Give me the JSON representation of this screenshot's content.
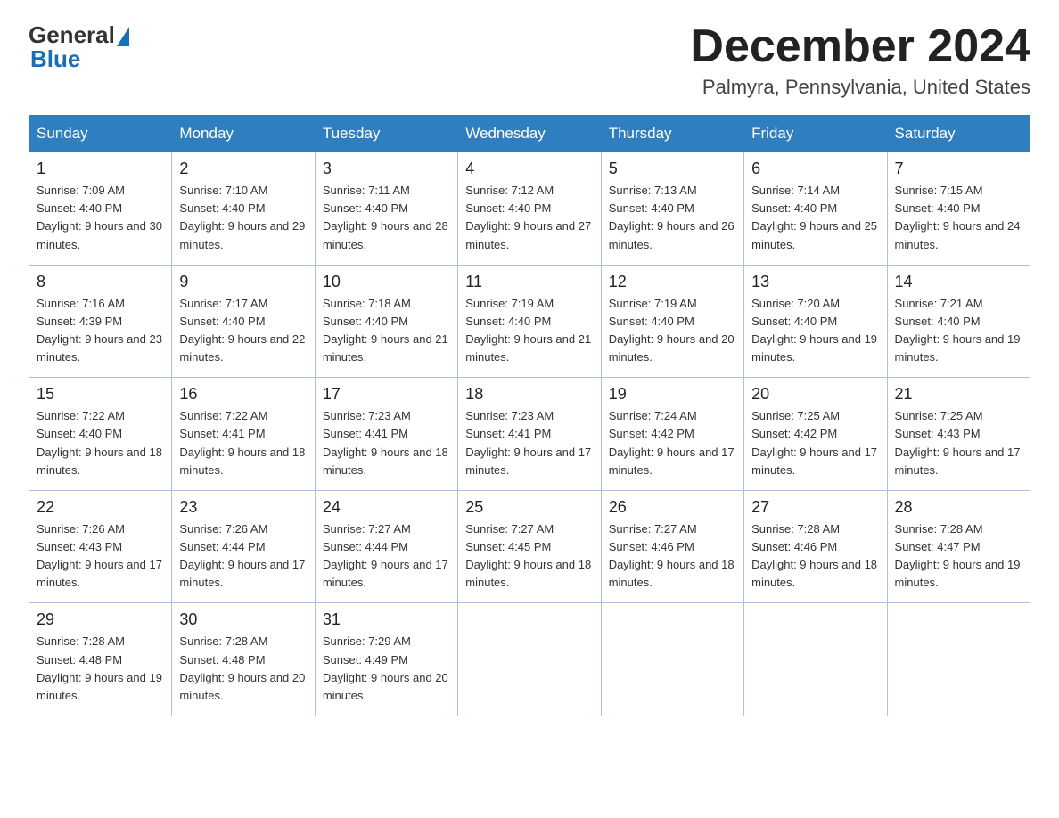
{
  "header": {
    "logo_general": "General",
    "logo_blue": "Blue",
    "month_title": "December 2024",
    "location": "Palmyra, Pennsylvania, United States"
  },
  "days_of_week": [
    "Sunday",
    "Monday",
    "Tuesday",
    "Wednesday",
    "Thursday",
    "Friday",
    "Saturday"
  ],
  "weeks": [
    [
      {
        "day": "1",
        "sunrise": "7:09 AM",
        "sunset": "4:40 PM",
        "daylight": "9 hours and 30 minutes."
      },
      {
        "day": "2",
        "sunrise": "7:10 AM",
        "sunset": "4:40 PM",
        "daylight": "9 hours and 29 minutes."
      },
      {
        "day": "3",
        "sunrise": "7:11 AM",
        "sunset": "4:40 PM",
        "daylight": "9 hours and 28 minutes."
      },
      {
        "day": "4",
        "sunrise": "7:12 AM",
        "sunset": "4:40 PM",
        "daylight": "9 hours and 27 minutes."
      },
      {
        "day": "5",
        "sunrise": "7:13 AM",
        "sunset": "4:40 PM",
        "daylight": "9 hours and 26 minutes."
      },
      {
        "day": "6",
        "sunrise": "7:14 AM",
        "sunset": "4:40 PM",
        "daylight": "9 hours and 25 minutes."
      },
      {
        "day": "7",
        "sunrise": "7:15 AM",
        "sunset": "4:40 PM",
        "daylight": "9 hours and 24 minutes."
      }
    ],
    [
      {
        "day": "8",
        "sunrise": "7:16 AM",
        "sunset": "4:39 PM",
        "daylight": "9 hours and 23 minutes."
      },
      {
        "day": "9",
        "sunrise": "7:17 AM",
        "sunset": "4:40 PM",
        "daylight": "9 hours and 22 minutes."
      },
      {
        "day": "10",
        "sunrise": "7:18 AM",
        "sunset": "4:40 PM",
        "daylight": "9 hours and 21 minutes."
      },
      {
        "day": "11",
        "sunrise": "7:19 AM",
        "sunset": "4:40 PM",
        "daylight": "9 hours and 21 minutes."
      },
      {
        "day": "12",
        "sunrise": "7:19 AM",
        "sunset": "4:40 PM",
        "daylight": "9 hours and 20 minutes."
      },
      {
        "day": "13",
        "sunrise": "7:20 AM",
        "sunset": "4:40 PM",
        "daylight": "9 hours and 19 minutes."
      },
      {
        "day": "14",
        "sunrise": "7:21 AM",
        "sunset": "4:40 PM",
        "daylight": "9 hours and 19 minutes."
      }
    ],
    [
      {
        "day": "15",
        "sunrise": "7:22 AM",
        "sunset": "4:40 PM",
        "daylight": "9 hours and 18 minutes."
      },
      {
        "day": "16",
        "sunrise": "7:22 AM",
        "sunset": "4:41 PM",
        "daylight": "9 hours and 18 minutes."
      },
      {
        "day": "17",
        "sunrise": "7:23 AM",
        "sunset": "4:41 PM",
        "daylight": "9 hours and 18 minutes."
      },
      {
        "day": "18",
        "sunrise": "7:23 AM",
        "sunset": "4:41 PM",
        "daylight": "9 hours and 17 minutes."
      },
      {
        "day": "19",
        "sunrise": "7:24 AM",
        "sunset": "4:42 PM",
        "daylight": "9 hours and 17 minutes."
      },
      {
        "day": "20",
        "sunrise": "7:25 AM",
        "sunset": "4:42 PM",
        "daylight": "9 hours and 17 minutes."
      },
      {
        "day": "21",
        "sunrise": "7:25 AM",
        "sunset": "4:43 PM",
        "daylight": "9 hours and 17 minutes."
      }
    ],
    [
      {
        "day": "22",
        "sunrise": "7:26 AM",
        "sunset": "4:43 PM",
        "daylight": "9 hours and 17 minutes."
      },
      {
        "day": "23",
        "sunrise": "7:26 AM",
        "sunset": "4:44 PM",
        "daylight": "9 hours and 17 minutes."
      },
      {
        "day": "24",
        "sunrise": "7:27 AM",
        "sunset": "4:44 PM",
        "daylight": "9 hours and 17 minutes."
      },
      {
        "day": "25",
        "sunrise": "7:27 AM",
        "sunset": "4:45 PM",
        "daylight": "9 hours and 18 minutes."
      },
      {
        "day": "26",
        "sunrise": "7:27 AM",
        "sunset": "4:46 PM",
        "daylight": "9 hours and 18 minutes."
      },
      {
        "day": "27",
        "sunrise": "7:28 AM",
        "sunset": "4:46 PM",
        "daylight": "9 hours and 18 minutes."
      },
      {
        "day": "28",
        "sunrise": "7:28 AM",
        "sunset": "4:47 PM",
        "daylight": "9 hours and 19 minutes."
      }
    ],
    [
      {
        "day": "29",
        "sunrise": "7:28 AM",
        "sunset": "4:48 PM",
        "daylight": "9 hours and 19 minutes."
      },
      {
        "day": "30",
        "sunrise": "7:28 AM",
        "sunset": "4:48 PM",
        "daylight": "9 hours and 20 minutes."
      },
      {
        "day": "31",
        "sunrise": "7:29 AM",
        "sunset": "4:49 PM",
        "daylight": "9 hours and 20 minutes."
      },
      null,
      null,
      null,
      null
    ]
  ],
  "labels": {
    "sunrise_prefix": "Sunrise: ",
    "sunset_prefix": "Sunset: ",
    "daylight_prefix": "Daylight: "
  }
}
